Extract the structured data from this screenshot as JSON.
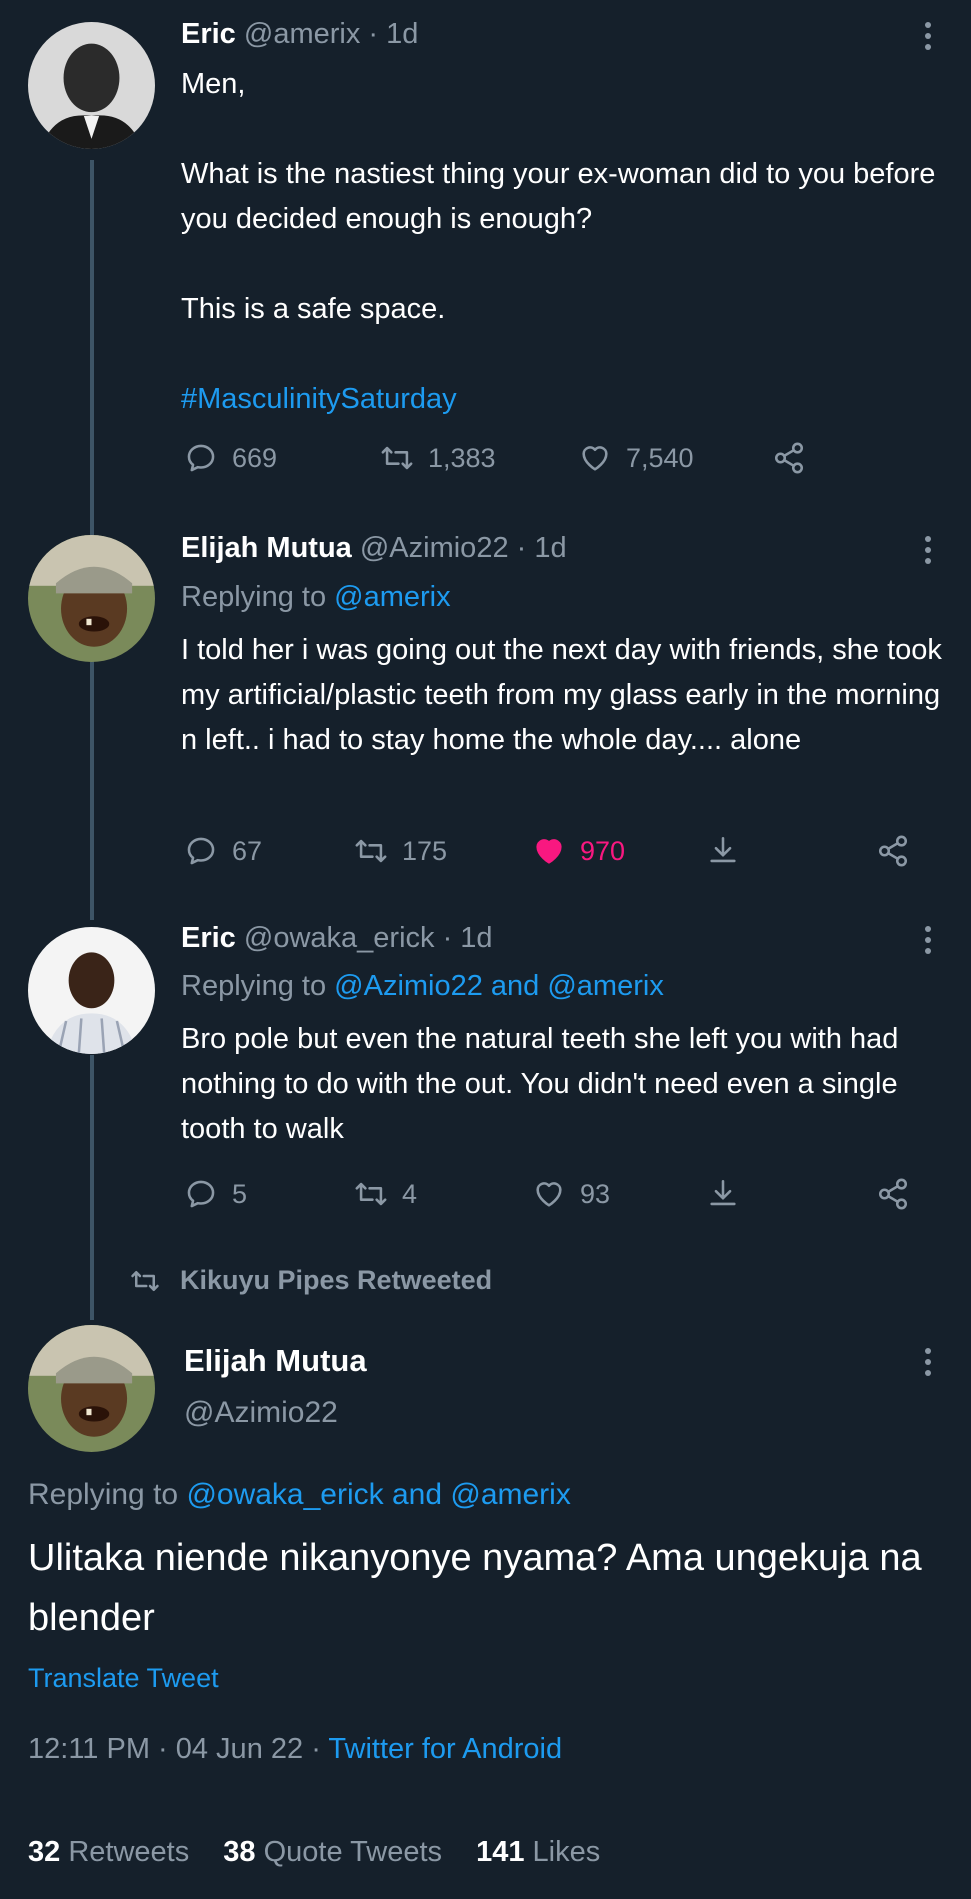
{
  "tweets": [
    {
      "name": "Eric",
      "handle": "@amerix",
      "time": "· 1d",
      "text_plain_1": "Men,\n\nWhat is the nastiest thing your ex-woman did to you before you decided enough is enough?\n\nThis is a safe space.\n\n",
      "hashtag": "#MasculinitySaturday",
      "replies": "669",
      "retweets": "1,383",
      "likes": "7,540"
    },
    {
      "name": "Elijah Mutua",
      "handle": "@Azimio22",
      "time": "· 1d",
      "replying_prefix": "Replying to",
      "replying_to": "@amerix",
      "text": "I told her i was going out the next day with friends, she took my artificial/plastic teeth from my glass early in the morning n left.. i had to stay home the whole day.... alone",
      "replies": "67",
      "retweets": "175",
      "likes": "970",
      "liked": true
    },
    {
      "name": "Eric",
      "handle": "@owaka_erick",
      "time": "· 1d",
      "replying_prefix": "Replying to",
      "replying_to": "@Azimio22 and @amerix",
      "text": "Bro pole but even the natural teeth she left you with had nothing to do with the out.  You didn't need even a single tooth to walk",
      "replies": "5",
      "retweets": "4",
      "likes": "93"
    }
  ],
  "retweeted_by": "Kikuyu Pipes Retweeted",
  "main_tweet": {
    "name": "Elijah Mutua",
    "handle": "@Azimio22",
    "replying_prefix": "Replying to",
    "replying_to": "@owaka_erick and @amerix",
    "text": "Ulitaka niende nikanyonye nyama? Ama ungekuja na blender",
    "translate": "Translate Tweet",
    "timestamp": "12:11 PM · 04 Jun 22 · ",
    "source": "Twitter for Android",
    "stats": {
      "retweets_count": "32",
      "retweets_label": "Retweets",
      "quotes_count": "38",
      "quotes_label": "Quote Tweets",
      "likes_count": "141",
      "likes_label": "Likes"
    }
  },
  "colors": {
    "background": "#15202b",
    "accent": "#1d9bf0",
    "muted": "#8b98a5",
    "like": "#f91880",
    "thread_line": "#3d5466"
  },
  "icons": [
    "reply-icon",
    "retweet-icon",
    "heart-icon",
    "share-icon",
    "download-icon",
    "more-icon"
  ]
}
